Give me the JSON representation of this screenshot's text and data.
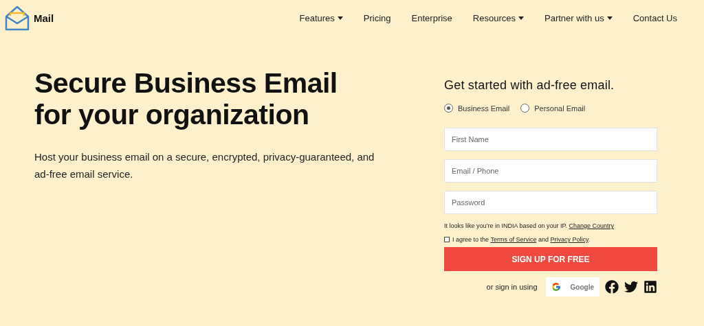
{
  "brand": {
    "name": "Mail"
  },
  "nav": [
    {
      "label": "Features",
      "dropdown": true
    },
    {
      "label": "Pricing",
      "dropdown": false
    },
    {
      "label": "Enterprise",
      "dropdown": false
    },
    {
      "label": "Resources",
      "dropdown": true
    },
    {
      "label": "Partner with us",
      "dropdown": true
    },
    {
      "label": "Contact Us",
      "dropdown": false
    }
  ],
  "hero": {
    "title_lines": [
      "Secure Business Email",
      "for your organization"
    ],
    "description": "Host your business email on a secure, encrypted, privacy-guaranteed, and ad-free email service."
  },
  "signup": {
    "heading": "Get started with ad-free email.",
    "account_types": [
      {
        "label": "Business Email",
        "selected": true
      },
      {
        "label": "Personal Email",
        "selected": false
      }
    ],
    "fields": [
      {
        "placeholder": "First Name"
      },
      {
        "placeholder": "Email / Phone"
      },
      {
        "placeholder": "Password"
      }
    ],
    "location_note": {
      "text": "It looks like you’re in INDIA based on your IP.",
      "link": "Change Country"
    },
    "agree": {
      "checked": false,
      "prefix": "I agree to the",
      "terms": "Terms of Service",
      "joiner": "and",
      "privacy": "Privacy Policy",
      "suffix": "."
    },
    "submit": "SIGN UP FOR FREE",
    "alt_signin": {
      "label": "or sign in using",
      "google": "Google"
    }
  }
}
